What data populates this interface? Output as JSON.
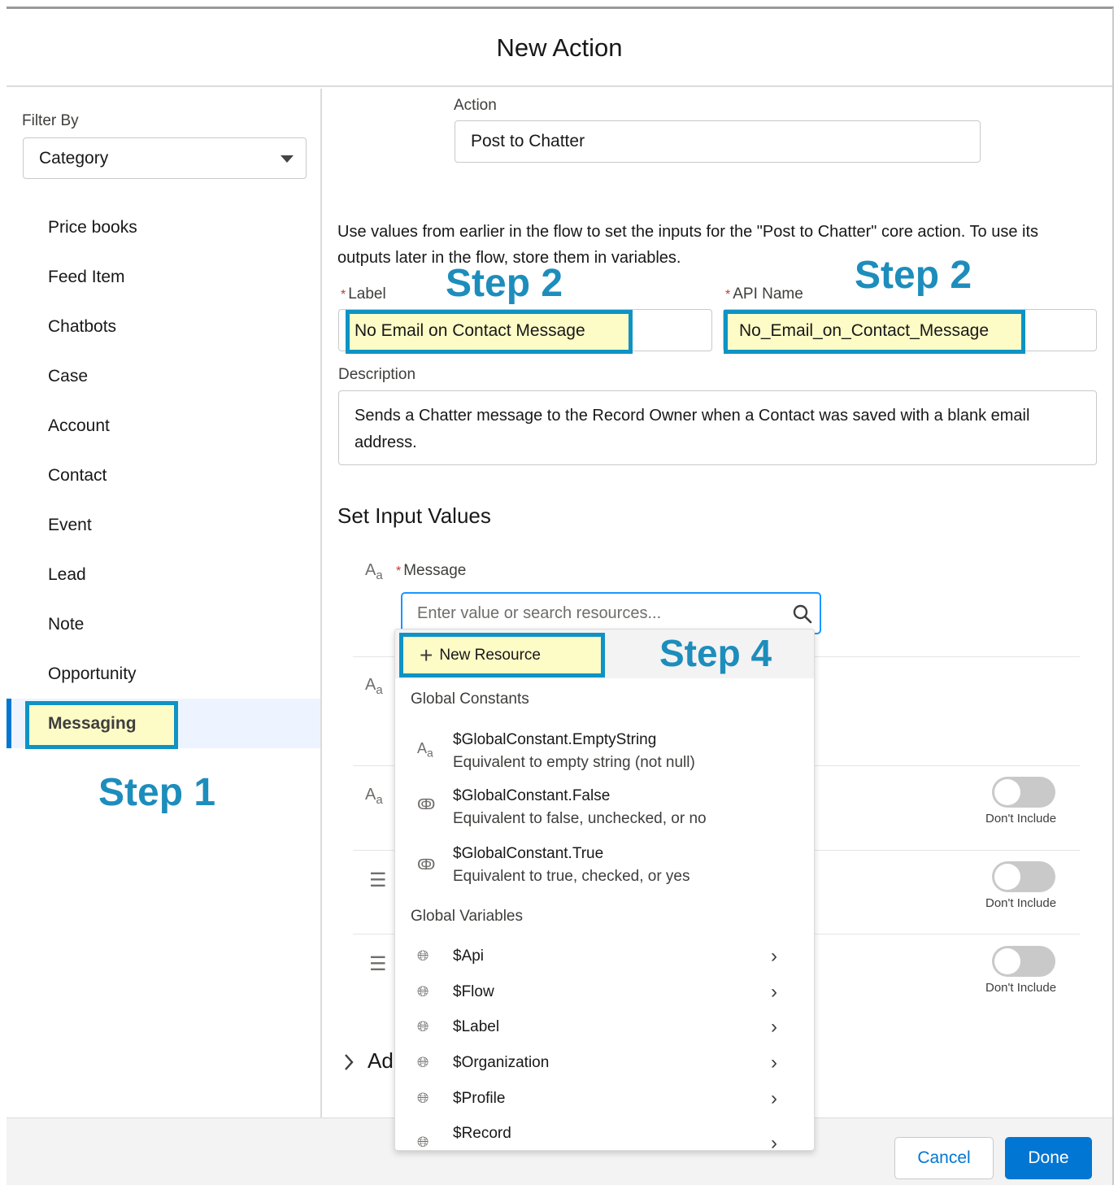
{
  "modal": {
    "title": "New Action"
  },
  "sidebar": {
    "filter_label": "Filter By",
    "filter_value": "Category",
    "items": [
      {
        "label": "Price books"
      },
      {
        "label": "Feed Item"
      },
      {
        "label": "Chatbots"
      },
      {
        "label": "Case"
      },
      {
        "label": "Account"
      },
      {
        "label": "Contact"
      },
      {
        "label": "Event"
      },
      {
        "label": "Lead"
      },
      {
        "label": "Note"
      },
      {
        "label": "Opportunity"
      },
      {
        "label": "Messaging",
        "selected": true
      }
    ]
  },
  "annotations": {
    "step1": "Step 1",
    "step2_label": "Step 2",
    "step2_api": "Step 2",
    "step4": "Step 4"
  },
  "form": {
    "action_label": "Action",
    "action_value": "Post to Chatter",
    "info_text": "Use values from earlier in the flow to set the inputs for the \"Post to Chatter\" core action. To use its outputs later in the flow, store them in variables.",
    "label_label": "Label",
    "label_value": "No Email on Contact Message",
    "api_label": "API Name",
    "api_value": "No_Email_on_Contact_Message",
    "description_label": "Description",
    "description_value": "Sends a Chatter message to the Record Owner when a Contact was saved with a blank email address.",
    "required_marker": "*"
  },
  "inputs": {
    "section_title": "Set Input Values",
    "message_label": "Message",
    "message_placeholder": "Enter value or search resources...",
    "toggle_label": "Don't Include",
    "toggles_on": [
      false,
      false,
      false
    ],
    "advanced_label": "Ad"
  },
  "dropdown": {
    "new_resource": "New Resource",
    "global_constants_header": "Global Constants",
    "constants": [
      {
        "title": "$GlobalConstant.EmptyString",
        "subtitle": "Equivalent to empty string (not null)",
        "icon": "text-icon"
      },
      {
        "title": "$GlobalConstant.False",
        "subtitle": "Equivalent to false, unchecked, or no",
        "icon": "boolean-icon"
      },
      {
        "title": "$GlobalConstant.True",
        "subtitle": "Equivalent to true, checked, or yes",
        "icon": "boolean-icon"
      }
    ],
    "global_variables_header": "Global Variables",
    "variables": [
      {
        "title": "$Api"
      },
      {
        "title": "$Flow"
      },
      {
        "title": "$Label"
      },
      {
        "title": "$Organization"
      },
      {
        "title": "$Profile"
      },
      {
        "title": "$Record"
      }
    ]
  },
  "footer": {
    "cancel": "Cancel",
    "done": "Done"
  },
  "colors": {
    "brand": "#0176d3",
    "annotation": "#1d8dbc",
    "highlight_fill": "#fdfbc6",
    "highlight_border": "#0e93c4"
  }
}
